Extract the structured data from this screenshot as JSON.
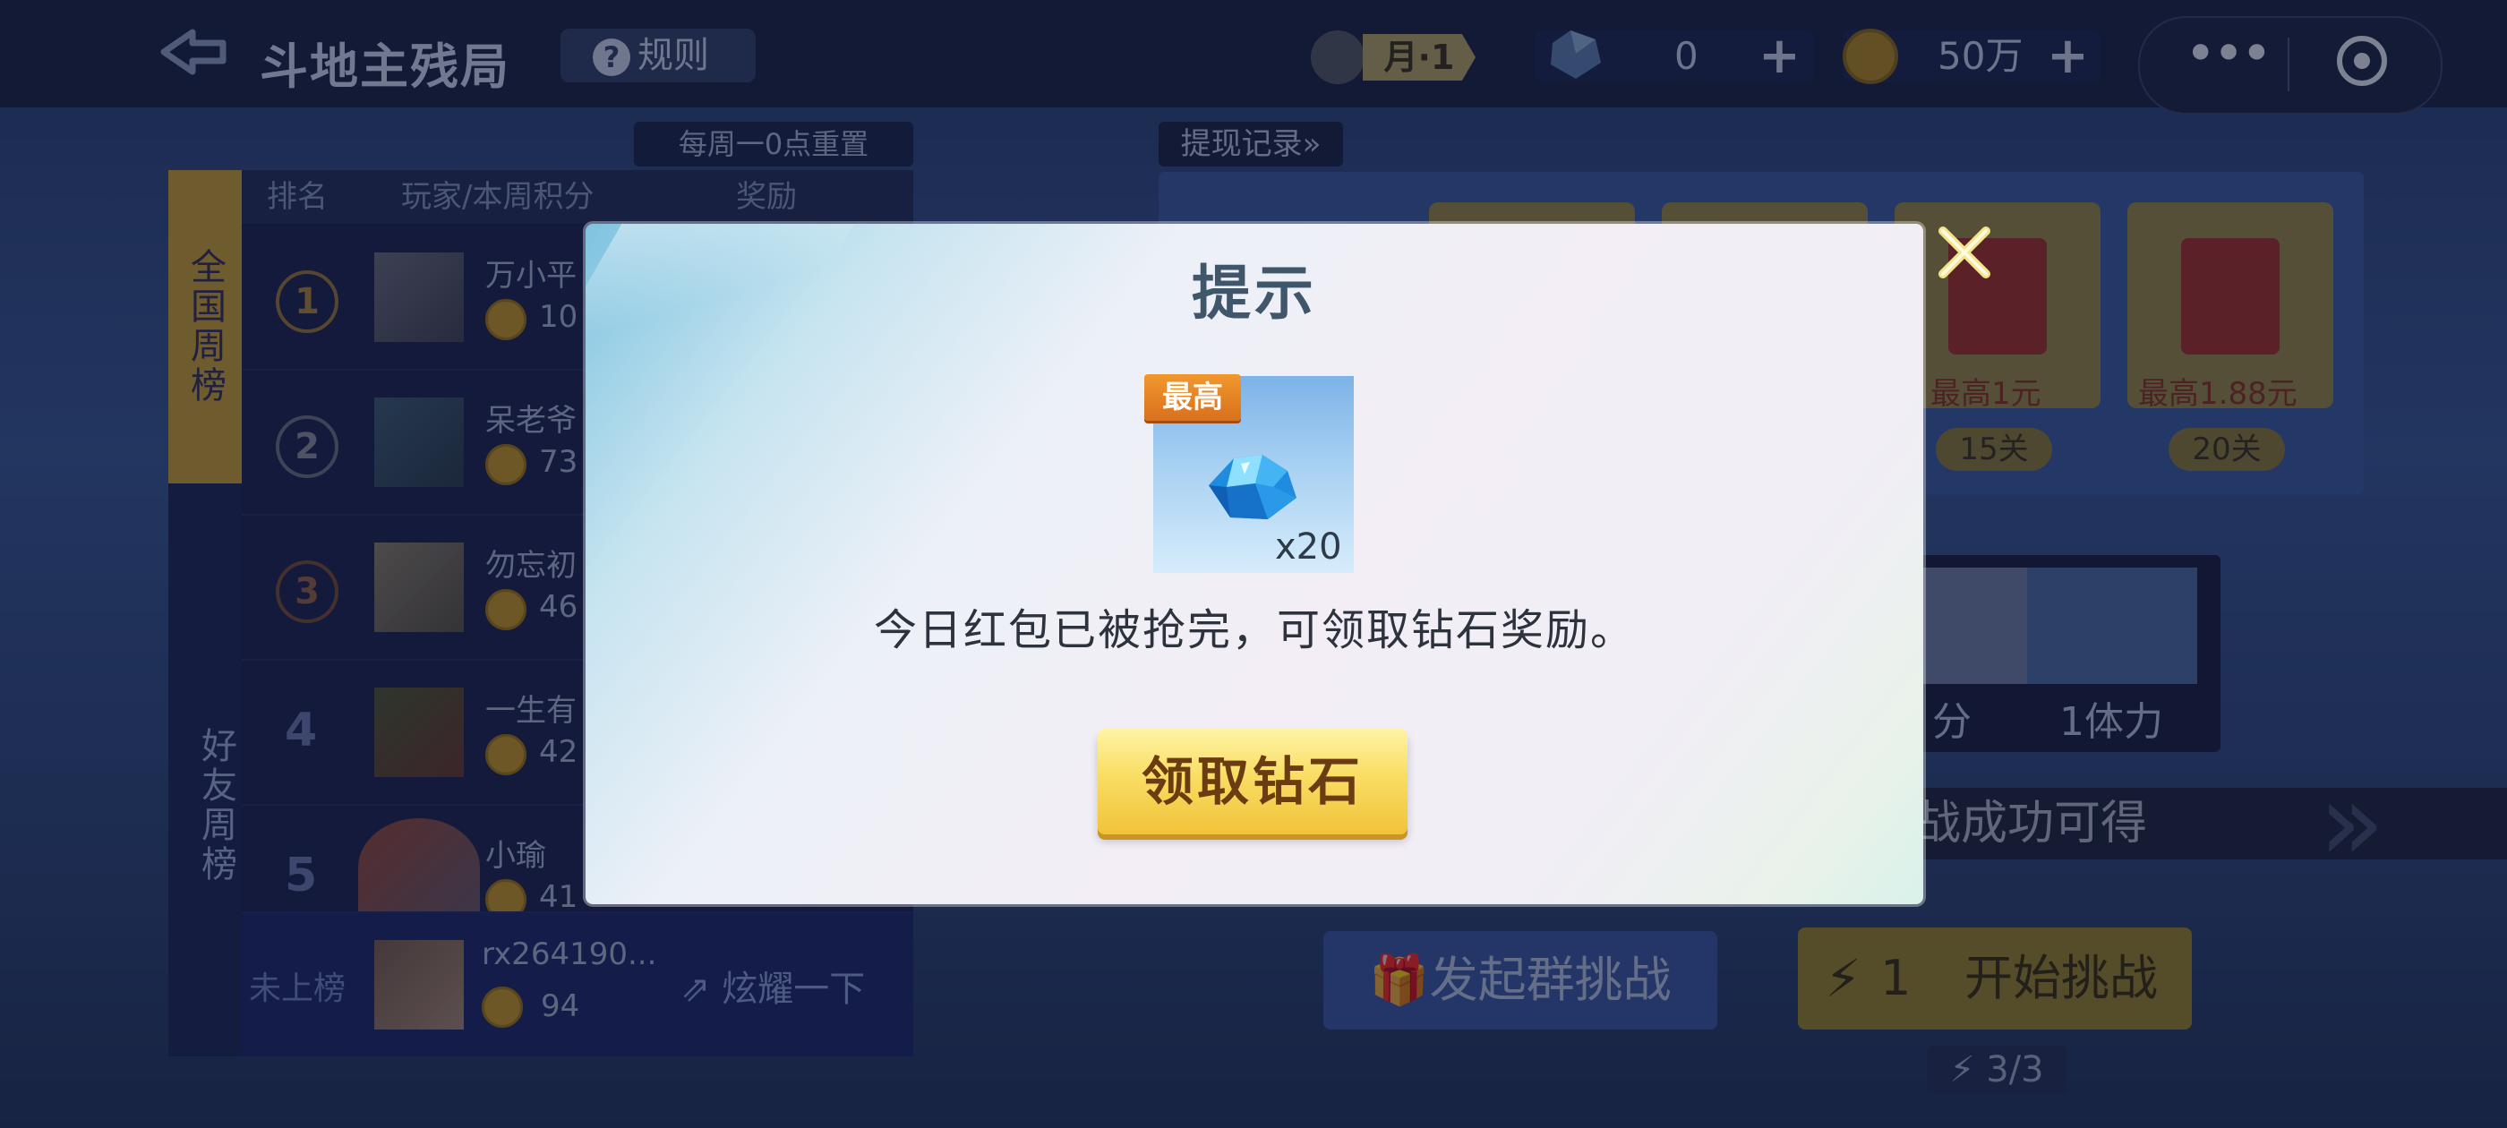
{
  "header": {
    "back_icon": "back-arrow-icon",
    "title": "斗地主残局",
    "rules_label": "规则",
    "rank_label": "月·1",
    "diamond_count": "0",
    "gold_count": "50万"
  },
  "leaderboard": {
    "reset_note": "每周一0点重置",
    "tab_national": "全国周榜",
    "tab_friends": "好友周榜",
    "columns": [
      "排名",
      "玩家/本周积分",
      "奖励"
    ],
    "rows": [
      {
        "rank": "1",
        "name": "万小平",
        "score": "10"
      },
      {
        "rank": "2",
        "name": "呆老爷",
        "score": "73"
      },
      {
        "rank": "3",
        "name": "勿忘初",
        "score": "46"
      },
      {
        "rank": "4",
        "name": "一生有",
        "score": "42"
      },
      {
        "rank": "5",
        "name": "小瑜",
        "score": "41"
      }
    ],
    "me": {
      "label": "未上榜",
      "name": "rx264190...",
      "score": "94",
      "brag": "炫耀一下"
    }
  },
  "right": {
    "withdraw": "提现记录»",
    "rewards": [
      {
        "amount": "最高1元",
        "level": "15关"
      },
      {
        "amount": "最高1.88元",
        "level": "20关"
      }
    ],
    "items": [
      "分",
      "1体力"
    ],
    "success_text": "战成功可得",
    "group_challenge": "发起群挑战",
    "start_cost": "1",
    "start_challenge": "开始挑战",
    "energy": "3/3"
  },
  "modal": {
    "title": "提示",
    "badge": "最高",
    "quantity": "x20",
    "message": "今日红包已被抢完，可领取钻石奖励。",
    "button": "领取钻石"
  },
  "colors": {
    "modal_title": "#40566a",
    "button_gold": "#f9dd63",
    "button_text": "#6b3c12",
    "badge_orange": "#e0802a"
  }
}
